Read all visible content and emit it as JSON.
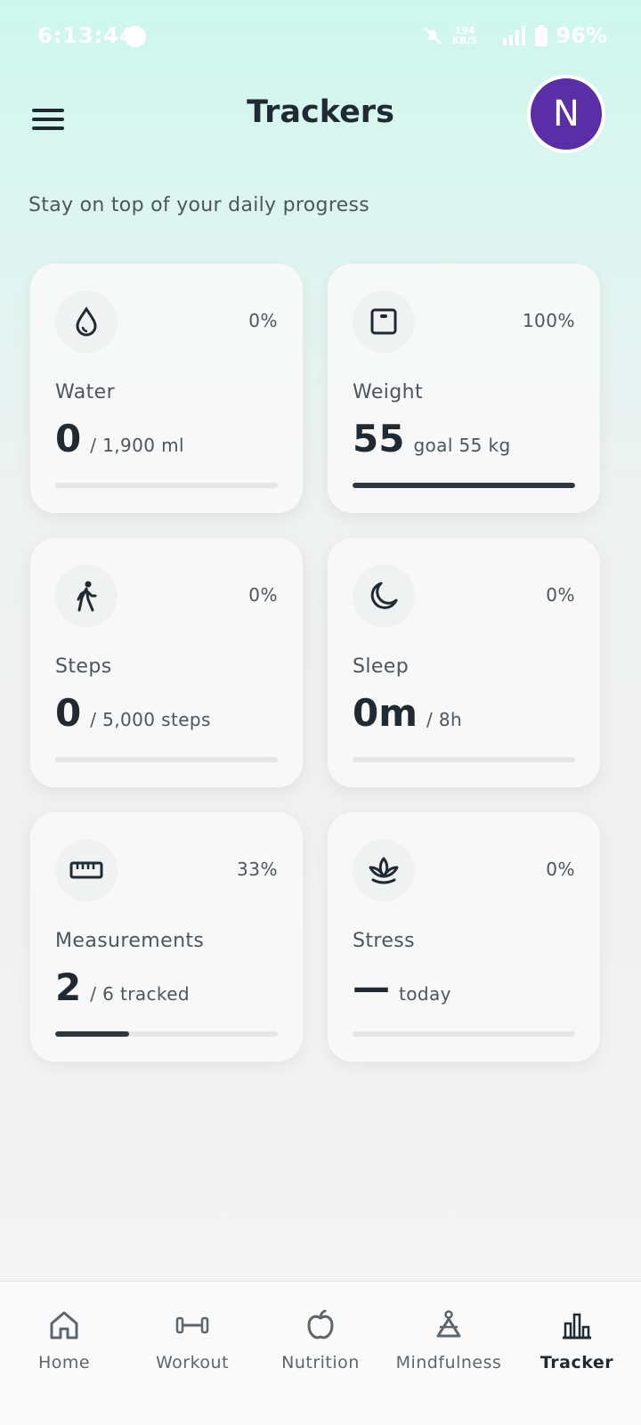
{
  "status_bar": {
    "time": "6:13:44",
    "net_speed_top": "194",
    "net_speed_bottom": "KB/S",
    "battery": "96%"
  },
  "header": {
    "title": "Trackers",
    "avatar_initial": "N",
    "avatar_color": "#5a2ea6"
  },
  "subtitle": "Stay on top of your daily progress",
  "trackers": [
    {
      "icon": "water-drop-icon",
      "percent": "0%",
      "label": "Water",
      "value": "0",
      "unit": "/ 1,900 ml",
      "progress": 0
    },
    {
      "icon": "scale-icon",
      "percent": "100%",
      "label": "Weight",
      "value": "55",
      "unit": "goal 55 kg",
      "progress": 1.0
    },
    {
      "icon": "walking-icon",
      "percent": "0%",
      "label": "Steps",
      "value": "0",
      "unit": "/ 5,000 steps",
      "progress": 0
    },
    {
      "icon": "moon-icon",
      "percent": "0%",
      "label": "Sleep",
      "value": "0m",
      "unit": "/ 8h",
      "progress": 0
    },
    {
      "icon": "ruler-icon",
      "percent": "33%",
      "label": "Measurements",
      "value": "2",
      "unit": "/ 6 tracked",
      "progress": 0.33
    },
    {
      "icon": "lotus-icon",
      "percent": "0%",
      "label": "Stress",
      "value": "—",
      "unit": "today",
      "progress": 0
    }
  ],
  "nav": {
    "items": [
      {
        "label": "Home",
        "icon": "home-icon",
        "active": false
      },
      {
        "label": "Workout",
        "icon": "dumbbell-icon",
        "active": false
      },
      {
        "label": "Nutrition",
        "icon": "apple-icon",
        "active": false
      },
      {
        "label": "Mindfulness",
        "icon": "meditation-icon",
        "active": false
      },
      {
        "label": "Tracker",
        "icon": "chart-icon",
        "active": true
      }
    ]
  }
}
